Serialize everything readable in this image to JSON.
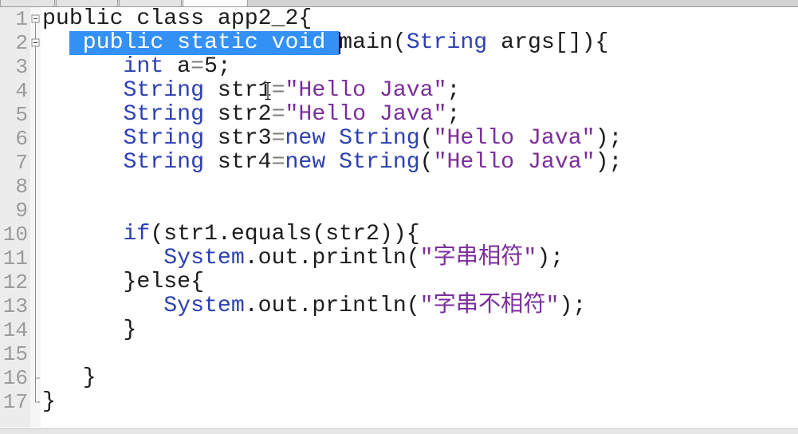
{
  "editor": {
    "colors": {
      "plain": "#1c1c1c",
      "keyword": "#2c3fb2",
      "string": "#7b2d9c",
      "operator": "#7c7c7c",
      "selection_bg": "#3390f4",
      "selection_text": "#ffffff",
      "line_number": "#9a9a9a"
    },
    "lines": [
      {
        "number": "1",
        "tokens": [
          {
            "text": "public class app2_2{",
            "kind": "plain"
          }
        ]
      },
      {
        "number": "2",
        "tokens": [
          {
            "text": "  ",
            "kind": "plain"
          },
          {
            "text": " public static void ",
            "kind": "selected"
          },
          {
            "text": "main(",
            "kind": "plain"
          },
          {
            "text": "String",
            "kind": "keyword"
          },
          {
            "text": " args[]){",
            "kind": "plain"
          }
        ]
      },
      {
        "number": "3",
        "tokens": [
          {
            "text": "      ",
            "kind": "plain"
          },
          {
            "text": "int",
            "kind": "keyword"
          },
          {
            "text": " a",
            "kind": "plain"
          },
          {
            "text": "=",
            "kind": "operator"
          },
          {
            "text": "5;",
            "kind": "plain"
          }
        ]
      },
      {
        "number": "4",
        "tokens": [
          {
            "text": "      ",
            "kind": "plain"
          },
          {
            "text": "String",
            "kind": "keyword"
          },
          {
            "text": " str1",
            "kind": "plain"
          },
          {
            "text": "=",
            "kind": "operator"
          },
          {
            "text": "\"Hello Java\"",
            "kind": "string"
          },
          {
            "text": ";",
            "kind": "plain"
          }
        ]
      },
      {
        "number": "5",
        "tokens": [
          {
            "text": "      ",
            "kind": "plain"
          },
          {
            "text": "String",
            "kind": "keyword"
          },
          {
            "text": " str2",
            "kind": "plain"
          },
          {
            "text": "=",
            "kind": "operator"
          },
          {
            "text": "\"Hello Java\"",
            "kind": "string"
          },
          {
            "text": ";",
            "kind": "plain"
          }
        ]
      },
      {
        "number": "6",
        "tokens": [
          {
            "text": "      ",
            "kind": "plain"
          },
          {
            "text": "String",
            "kind": "keyword"
          },
          {
            "text": " str3",
            "kind": "plain"
          },
          {
            "text": "=",
            "kind": "operator"
          },
          {
            "text": "new",
            "kind": "keyword"
          },
          {
            "text": " ",
            "kind": "plain"
          },
          {
            "text": "String",
            "kind": "keyword"
          },
          {
            "text": "(",
            "kind": "plain"
          },
          {
            "text": "\"Hello Java\"",
            "kind": "string"
          },
          {
            "text": ");",
            "kind": "plain"
          }
        ]
      },
      {
        "number": "7",
        "tokens": [
          {
            "text": "      ",
            "kind": "plain"
          },
          {
            "text": "String",
            "kind": "keyword"
          },
          {
            "text": " str4",
            "kind": "plain"
          },
          {
            "text": "=",
            "kind": "operator"
          },
          {
            "text": "new",
            "kind": "keyword"
          },
          {
            "text": " ",
            "kind": "plain"
          },
          {
            "text": "String",
            "kind": "keyword"
          },
          {
            "text": "(",
            "kind": "plain"
          },
          {
            "text": "\"Hello Java\"",
            "kind": "string"
          },
          {
            "text": ");",
            "kind": "plain"
          }
        ]
      },
      {
        "number": "8",
        "tokens": []
      },
      {
        "number": "9",
        "tokens": []
      },
      {
        "number": "10",
        "tokens": [
          {
            "text": "      ",
            "kind": "plain"
          },
          {
            "text": "if",
            "kind": "keyword"
          },
          {
            "text": "(str1.equals(str2)){",
            "kind": "plain"
          }
        ]
      },
      {
        "number": "11",
        "tokens": [
          {
            "text": "         ",
            "kind": "plain"
          },
          {
            "text": "System",
            "kind": "keyword"
          },
          {
            "text": ".out.println(",
            "kind": "plain"
          },
          {
            "text": "\"字串相符\"",
            "kind": "string"
          },
          {
            "text": ");",
            "kind": "plain"
          }
        ]
      },
      {
        "number": "12",
        "tokens": [
          {
            "text": "      }else{",
            "kind": "plain"
          }
        ]
      },
      {
        "number": "13",
        "tokens": [
          {
            "text": "         ",
            "kind": "plain"
          },
          {
            "text": "System",
            "kind": "keyword"
          },
          {
            "text": ".out.println(",
            "kind": "plain"
          },
          {
            "text": "\"字串不相符\"",
            "kind": "string"
          },
          {
            "text": ");",
            "kind": "plain"
          }
        ]
      },
      {
        "number": "14",
        "tokens": [
          {
            "text": "      }",
            "kind": "plain"
          }
        ]
      },
      {
        "number": "15",
        "tokens": []
      },
      {
        "number": "16",
        "tokens": [
          {
            "text": "   }",
            "kind": "plain"
          }
        ]
      },
      {
        "number": "17",
        "tokens": [
          {
            "text": "}",
            "kind": "plain"
          }
        ]
      }
    ]
  }
}
